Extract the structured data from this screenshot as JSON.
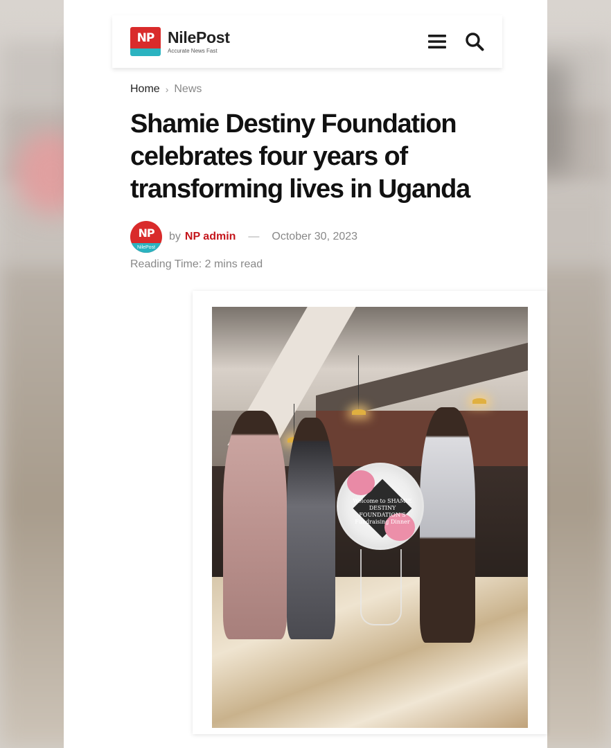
{
  "brand": {
    "logo_letters": "NP",
    "name": "NilePost",
    "tagline": "Accurate News Fast",
    "colors": {
      "red": "#d92b2b",
      "teal": "#2bb3c0",
      "author": "#c4161c"
    }
  },
  "header": {
    "menu_icon": "hamburger-menu-icon",
    "search_icon": "search-icon"
  },
  "breadcrumb": {
    "home": "Home",
    "current": "News"
  },
  "article": {
    "title": "Shamie Destiny Foundation celebrates four years of transforming lives in Uganda",
    "avatar_letters": "NP",
    "avatar_band": "NilePost",
    "by": "by",
    "author": "NP admin",
    "dash": "—",
    "date": "October 30, 2023",
    "reading_time": "Reading Time: 2 mins read"
  },
  "photo": {
    "sign_text": "Welcome to SHAMIE DESTINY FOUNDATION'S Fundraising Dinner"
  }
}
